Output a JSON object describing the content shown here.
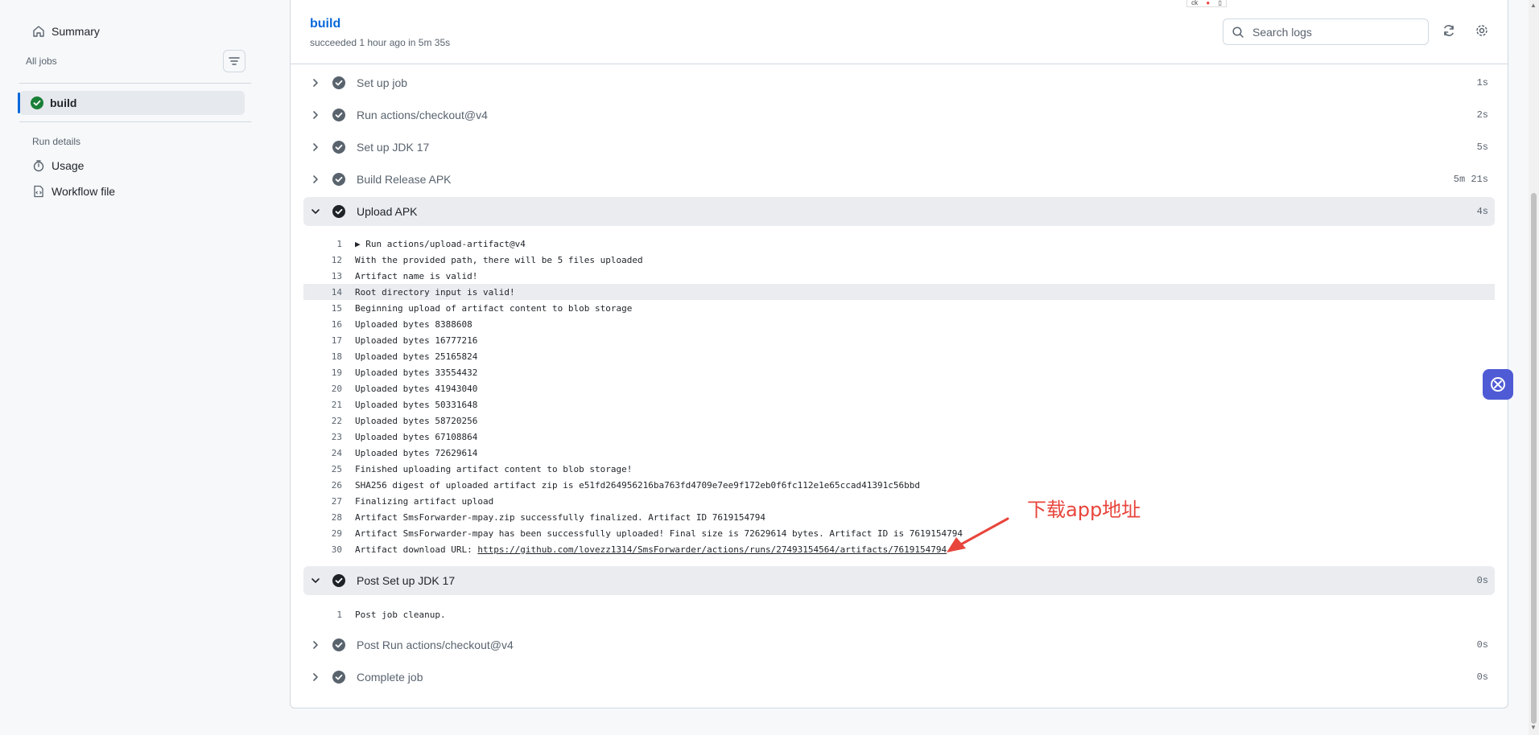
{
  "sidebar": {
    "summary_label": "Summary",
    "all_jobs_label": "All jobs",
    "job": {
      "label": "build",
      "status": "success"
    },
    "run_details_label": "Run details",
    "usage_label": "Usage",
    "workflow_file_label": "Workflow file"
  },
  "header": {
    "title": "build",
    "subtitle": "succeeded 1 hour ago in 5m 35s",
    "search_placeholder": "Search logs",
    "extension_badge": "ck"
  },
  "steps": [
    {
      "name": "Set up job",
      "time": "1s",
      "expanded": false
    },
    {
      "name": "Run actions/checkout@v4",
      "time": "2s",
      "expanded": false
    },
    {
      "name": "Set up JDK 17",
      "time": "5s",
      "expanded": false
    },
    {
      "name": "Build Release APK",
      "time": "5m 21s",
      "expanded": false
    },
    {
      "name": "Upload APK",
      "time": "4s",
      "expanded": true
    },
    {
      "name": "Post Set up JDK 17",
      "time": "0s",
      "expanded": true
    },
    {
      "name": "Post Run actions/checkout@v4",
      "time": "0s",
      "expanded": false
    },
    {
      "name": "Complete job",
      "time": "0s",
      "expanded": false
    }
  ],
  "upload_logs": [
    {
      "n": "1",
      "text": "▶ Run actions/upload-artifact@v4"
    },
    {
      "n": "12",
      "text": "With the provided path, there will be 5 files uploaded"
    },
    {
      "n": "13",
      "text": "Artifact name is valid!"
    },
    {
      "n": "14",
      "text": "Root directory input is valid!"
    },
    {
      "n": "15",
      "text": "Beginning upload of artifact content to blob storage"
    },
    {
      "n": "16",
      "text": "Uploaded bytes 8388608"
    },
    {
      "n": "17",
      "text": "Uploaded bytes 16777216"
    },
    {
      "n": "18",
      "text": "Uploaded bytes 25165824"
    },
    {
      "n": "19",
      "text": "Uploaded bytes 33554432"
    },
    {
      "n": "20",
      "text": "Uploaded bytes 41943040"
    },
    {
      "n": "21",
      "text": "Uploaded bytes 50331648"
    },
    {
      "n": "22",
      "text": "Uploaded bytes 58720256"
    },
    {
      "n": "23",
      "text": "Uploaded bytes 67108864"
    },
    {
      "n": "24",
      "text": "Uploaded bytes 72629614"
    },
    {
      "n": "25",
      "text": "Finished uploading artifact content to blob storage!"
    },
    {
      "n": "26",
      "text": "SHA256 digest of uploaded artifact zip is e51fd264956216ba763fd4709e7ee9f172eb0f6fc112e1e65ccad41391c56bbd"
    },
    {
      "n": "27",
      "text": "Finalizing artifact upload"
    },
    {
      "n": "28",
      "text": "Artifact SmsForwarder-mpay.zip successfully finalized. Artifact ID 7619154794"
    },
    {
      "n": "29",
      "text": "Artifact SmsForwarder-mpay has been successfully uploaded! Final size is 72629614 bytes. Artifact ID is 7619154794"
    },
    {
      "n": "30",
      "text": "Artifact download URL: ",
      "link": "https://github.com/lovezz1314/SmsForwarder/actions/runs/27493154564/artifacts/7619154794"
    }
  ],
  "highlighted_log_line": "14",
  "post_jdk_logs": [
    {
      "n": "1",
      "text": "Post job cleanup."
    }
  ],
  "annotation": {
    "text": "下载app地址",
    "color": "#e8453c"
  },
  "colors": {
    "accent": "#0969da",
    "success": "#1a7f37",
    "step_check": "#59636e",
    "annotation": "#e8453c"
  }
}
